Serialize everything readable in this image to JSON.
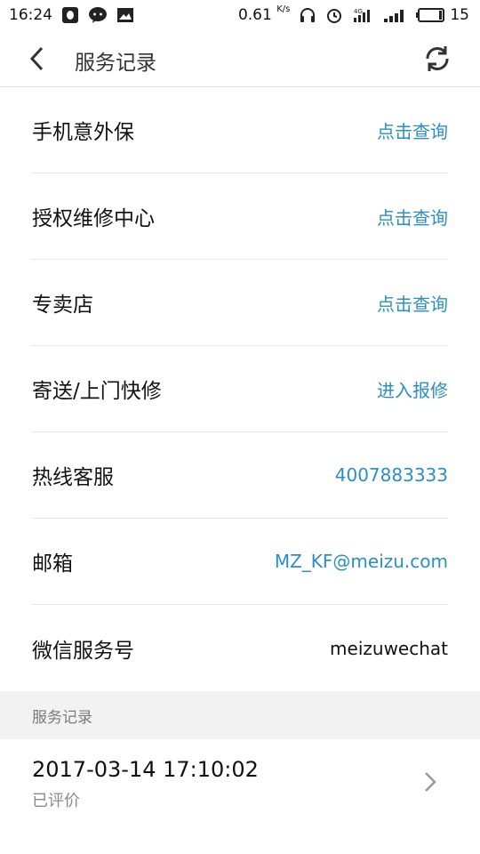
{
  "status_bar": {
    "time": "16:24",
    "net_speed": "0.61",
    "net_speed_unit": "K/s",
    "battery": "15",
    "icons": [
      "qq-icon",
      "wechat-icon",
      "image-icon",
      "headset-icon",
      "alarm-icon",
      "signal-4g-icon",
      "signal-icon",
      "battery-icon"
    ]
  },
  "header": {
    "title": "服务记录"
  },
  "rows": [
    {
      "label": "手机意外保",
      "value": "点击查询"
    },
    {
      "label": "授权维修中心",
      "value": "点击查询"
    },
    {
      "label": "专卖店",
      "value": "点击查询"
    },
    {
      "label": "寄送/上门快修",
      "value": "进入报修"
    },
    {
      "label": "热线客服",
      "value": "4007883333"
    },
    {
      "label": "邮箱",
      "value": "MZ_KF@meizu.com"
    },
    {
      "label": "微信服务号",
      "value": "meizuwechat"
    }
  ],
  "section": {
    "title": "服务记录"
  },
  "records": [
    {
      "time": "2017-03-14 17:10:02",
      "status": "已评价"
    }
  ],
  "colors": {
    "accent": "#2a8fc8",
    "section_bg": "#f2f2f2",
    "divider": "#e6e6e6"
  }
}
